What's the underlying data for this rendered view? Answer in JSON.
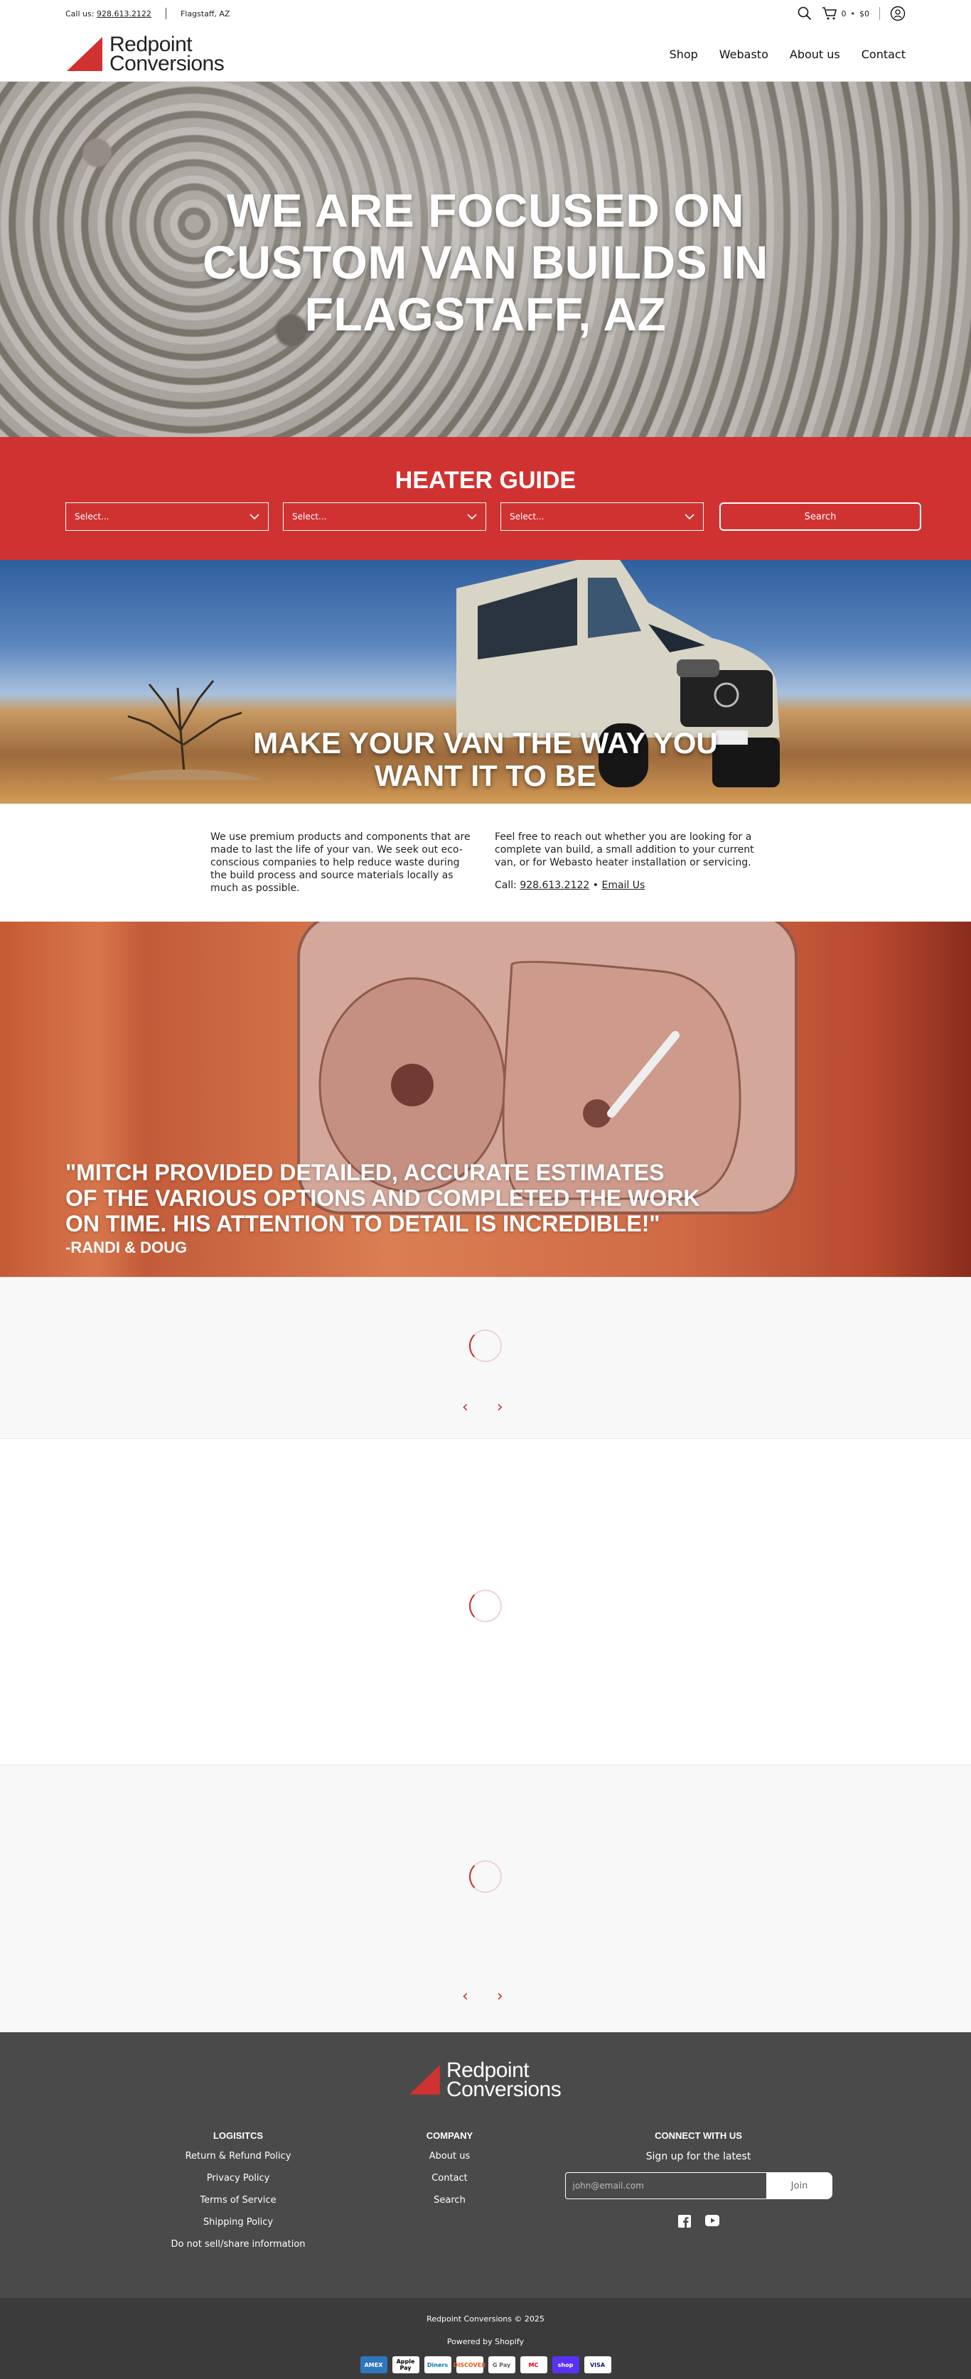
{
  "topbar": {
    "call_label": "Call us:",
    "phone": "928.613.2122",
    "location": "Flagstaff, AZ",
    "cart_count": "0",
    "cart_dot": "•",
    "cart_total": "$0"
  },
  "brand": {
    "line1": "Redpoint",
    "line2": "Conversions",
    "accent": "#d03232"
  },
  "nav": [
    {
      "label": "Shop"
    },
    {
      "label": "Webasto"
    },
    {
      "label": "About us"
    },
    {
      "label": "Contact"
    }
  ],
  "hero": {
    "line1": "WE ARE FOCUSED ON",
    "line2": "CUSTOM VAN BUILDS IN",
    "line3": "FLAGSTAFF, AZ"
  },
  "heater_guide": {
    "title": "HEATER GUIDE",
    "selects": [
      "Select...",
      "Select...",
      "Select..."
    ],
    "search_label": "Search"
  },
  "van_banner": {
    "line1": "MAKE YOUR VAN THE WAY YOU",
    "line2": "WANT IT TO BE"
  },
  "about": {
    "left": "We use premium products and components that are made to last the life of your van. We seek out eco-conscious companies to help reduce waste during the build process and source materials locally as much as possible.",
    "right": "Feel free to reach out whether you are looking for a complete van build, a small addition to your current van, or for Webasto heater installation or servicing.",
    "call_label": "Call:",
    "phone": "928.613.2122",
    "bullet": "•",
    "email_label": "Email Us"
  },
  "testimonial": {
    "line1": "\"MITCH PROVIDED DETAILED, ACCURATE ESTIMATES",
    "line2": "OF THE VARIOUS OPTIONS AND COMPLETED THE WORK",
    "line3": "ON TIME. HIS ATTENTION TO DETAIL IS INCREDIBLE!\"",
    "author": "-RANDI & DOUG"
  },
  "carousel": {
    "prev": "‹",
    "next": "›"
  },
  "footer": {
    "logistics": {
      "title": "LOGISITCS",
      "items": [
        "Return & Refund Policy",
        "Privacy Policy",
        "Terms of Service",
        "Shipping Policy",
        "Do not sell/share information"
      ]
    },
    "company": {
      "title": "COMPANY",
      "items": [
        "About us",
        "Contact",
        "Search"
      ]
    },
    "connect": {
      "title": "CONNECT WITH US",
      "signup": "Sign up for the latest",
      "placeholder": "john@email.com",
      "join": "Join"
    },
    "copyright": "Redpoint Conversions © 2025",
    "powered": "Powered by Shopify",
    "payments": [
      "AMEX",
      "Apple Pay",
      "Diners",
      "DISCOVER",
      "G Pay",
      "MC",
      "shop",
      "VISA"
    ]
  }
}
